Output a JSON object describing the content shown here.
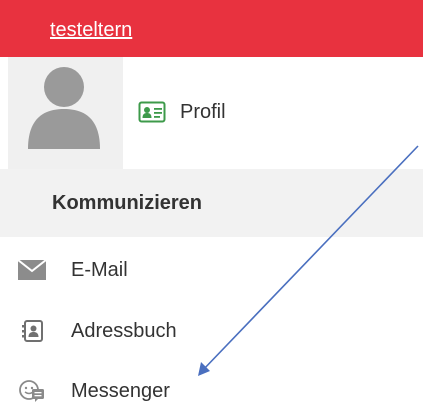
{
  "header": {
    "username": "testeltern",
    "accent_color": "#e8323f"
  },
  "profile": {
    "avatar_icon": "user-silhouette-icon",
    "link_icon": "id-card-icon",
    "link_label": "Profil"
  },
  "communicate": {
    "title": "Kommunizieren",
    "items": [
      {
        "label": "E-Mail",
        "icon": "envelope-icon"
      },
      {
        "label": "Adressbuch",
        "icon": "address-book-icon"
      },
      {
        "label": "Messenger",
        "icon": "chat-bubbles-icon"
      }
    ]
  },
  "annotation": {
    "type": "arrow",
    "color": "#4a6fbf",
    "points_to": "Messenger"
  }
}
